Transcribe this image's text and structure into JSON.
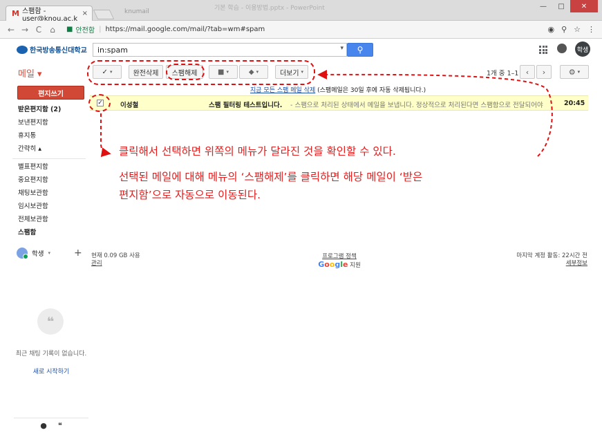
{
  "browser": {
    "tab_title": "스팸함 - user@knou.ac.k",
    "tab_close": "×",
    "gmail_mark": "M",
    "faint_title": "기본 학습 - 이용방법.pptx - PowerPoint",
    "faint_user": "knumail",
    "nav_back": "←",
    "nav_forward": "→",
    "nav_reload": "C",
    "nav_home": "⌂",
    "secure_label": "안전함",
    "url": "https://mail.google.com/mail/?tab=wm#spam",
    "win_min": "—",
    "win_max": "□",
    "win_close": "✕",
    "addr_icons": [
      "◉",
      "⚲",
      "☆",
      "⋮"
    ]
  },
  "header": {
    "logo_text": "한국방송통신대학교",
    "search_value": "in:spam",
    "search_dd": "▾",
    "search_icon": "⚲",
    "user_avatar": "학생"
  },
  "sidebar": {
    "mail_label": "메일 ▾",
    "compose": "편지쓰기",
    "items": [
      {
        "label": "받은편지함 (2)"
      },
      {
        "label": "보낸편지함"
      },
      {
        "label": "휴지통"
      },
      {
        "label": "간략히 ▴"
      },
      {
        "label": "별표편지함"
      },
      {
        "label": "중요편지함"
      },
      {
        "label": "채팅보관함"
      },
      {
        "label": "임시보관함"
      },
      {
        "label": "전체보관함"
      },
      {
        "label": "스팸함"
      }
    ],
    "chat_user": "학생",
    "chat_user_caret": "▾",
    "chat_add": "+",
    "hangout_glyph": "❝",
    "no_chat": "최근 채팅 기록이 없습니다.",
    "start_chat": "새로 시작하기",
    "bottom_icons": [
      "●",
      "❝"
    ]
  },
  "toolbar": {
    "select_icon": "✓",
    "caret": "▾",
    "delete_forever": "완전삭제",
    "not_spam": "스팸해제",
    "folder_icon": "■",
    "label_icon": "◆",
    "more": "더보기",
    "page_count": "1개 중 1–1",
    "prev": "‹",
    "next": "›",
    "settings_icon": "⚙"
  },
  "spam_notice": {
    "link": "지금 모든 스팸 메일 삭제",
    "text": "(스팸메일은 30일 후에 자동 삭제됩니다.)"
  },
  "mail": {
    "checked": "✓",
    "sender": "이성철",
    "subject": "스팸 필터링 테스트입니다.",
    "snippet": " - 스팸으로 처리된 상태에서 메일을 보냅니다. 정상적으로 처리된다면 스팸함으로 전달되어야 합니다.",
    "time": "20:45"
  },
  "footer": {
    "usage": "현재 0.09 GB 사용",
    "manage": "관리",
    "program_policy": "프로그램 정책",
    "google": [
      "G",
      "o",
      "o",
      "g",
      "l",
      "e"
    ],
    "support": "지원",
    "last_activity": "마지막 계정 활동: 22시간 전",
    "details": "세부정보"
  },
  "annotations": {
    "line1": "클릭해서 선택하면 위쪽의 메뉴가 달라진 것을 확인할 수 있다.",
    "line2": "선택된 메일에 대해 메뉴의 ‘스팸해제’를 클릭하면 해당 메일이  ‘받은",
    "line3": "편지함’으로 자동으로 이동된다.",
    "color": "#e41c1c"
  }
}
